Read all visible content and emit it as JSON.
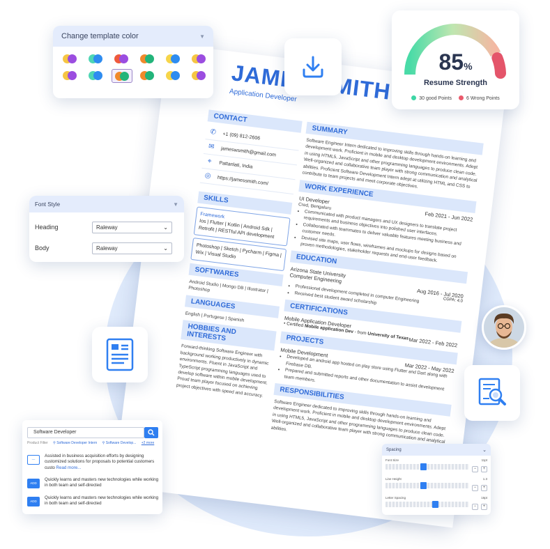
{
  "resume": {
    "name": "JAMES SMITH",
    "job_title": "Application Developer",
    "sections": {
      "contact": "CONTACT",
      "summary": "SUMMARY",
      "skills": "SKILLS",
      "work_experience": "WORK EXPERIENCE",
      "softwares": "SOFTWARES",
      "languages": "LANGUAGES",
      "education": "EDUCATION",
      "hobbies": "HOBBIES AND INTERESTS",
      "certifications": "CERTIFICATIONS",
      "projects": "PROJECTS",
      "responsibilities": "RESPONSIBILITIES"
    },
    "contact": {
      "phone": "+1 (09) 812-2606",
      "email": "jameswsmith@gmail.com",
      "location": "Pattanlati, India",
      "website": "https://jamessmith.com/"
    },
    "summary_text": "Software Engineer Intern dedicated to improving skills through hands-on learning and development work. Proficient in mobile and desktop development environments. Adept in using HTML5, JavaScript and other programming languages to produce clean code. Well-organized and collaborative team player with strong communication and analytical abilities. Proficient Software Development Intern adept at utilizing HTML and CSS to contribute to team projects and meet corporate objectives.",
    "skills": {
      "group1_title": "Framework",
      "group1": "Ios | Flutter | Kotlin | Android Sdk | Retrofit | RESTful API development",
      "group2": "Photoshop | Sketch | Pycharm | Figma | Wix | Visual Studio"
    },
    "work": {
      "role": "UI Developer",
      "company": "Cred, Bengaluru",
      "dates": "Feb 2021 - Jun 2022",
      "bullets": [
        "Communicated with product managers and UX designers to translate project requirements and business objectives into polished user interfaces.",
        "Collaborated with teammates to deliver valuable features meeting business and customer needs.",
        "Devised site maps, user flows, wireframes and mockups for designs based on proven methodologies, stakeholder requests and end-user feedback."
      ]
    },
    "softwares": "Android Studio | Mongo DB | Illustrator | Photoshop",
    "languages": "English | Portugese | Spanish",
    "education": {
      "school": "Arizona State University",
      "degree": "Computer Engineering",
      "dates": "Aug 2016 - Jul 2020",
      "cgpa": "CGPA: 4.0",
      "bullets": [
        "Professional development completed in computer Engineering",
        "Received best student award scholarship"
      ]
    },
    "hobbies_text": "Forward-thinking Software Engineer with background working productively in dynamic environments. Fluent in JavaScript and TypeScript programming languages used to develop software within mobile development. Proud team player focused on achieving project objectives with speed and accuracy.",
    "certification": {
      "title": "Mobile Application Developer",
      "dates": "Mar 2022 - Feb 2022",
      "certified_label": "Certified",
      "cert_name": "Mobile application Dev",
      "from_label": "from",
      "from": "University of Texas"
    },
    "project": {
      "title": "Mobile Development",
      "dates": "Mar 2022 - May 2022",
      "bullets": [
        "Developed an android app hosted on play store using Flutter and Dart along with Firebase DB.",
        "Prepared and submitted reports and other documentation to assist development team members."
      ]
    },
    "responsibilities_text": "Software Engineer dedicated to improving skills through hands-on learning and development work. Proficient in mobile and desktop development environments. Adept in using HTML5, JavaScript and other programming languages to produce clean code. Well-organized and collaborative team player with strong communication and analytical abilities."
  },
  "color_panel": {
    "title": "Change template color",
    "swatches": [
      [
        "#f6c543",
        "#9b4de0"
      ],
      [
        "#4ed6b4",
        "#2e8cf0"
      ],
      [
        "#ef5a3c",
        "#9b4de0"
      ],
      [
        "#f08a2c",
        "#22b47a"
      ],
      [
        "#f6d54a",
        "#2e8cf0"
      ],
      [
        "#f6c543",
        "#9b4de0"
      ],
      [
        "#f6c543",
        "#9b4de0"
      ],
      [
        "#4ed6b4",
        "#2e8cf0"
      ],
      [
        "#f08a2c",
        "#22b47a"
      ],
      [
        "#f08a2c",
        "#22b47a"
      ],
      [
        "#f6d54a",
        "#2e8cf0"
      ],
      [
        "#f6c543",
        "#9b4de0"
      ]
    ],
    "selected_index": 8
  },
  "strength": {
    "value": 85,
    "unit": "%",
    "label": "Resume Strength",
    "good_label": "30 good Points",
    "wrong_label": "6 Wrong Points",
    "good_color": "#3ed6a5",
    "wrong_color": "#ea5a6c"
  },
  "font_style": {
    "title": "Font Style",
    "heading_label": "Heading",
    "heading_value": "Raleway",
    "body_label": "Body",
    "body_value": "Raleway"
  },
  "search": {
    "query": "Software Developer",
    "filter_label": "Product Filter",
    "chips": [
      "Software Developer Intern",
      "Software Develop..."
    ],
    "more": "+2 more",
    "results": [
      {
        "tag": "",
        "text": "Assisted in business acquisition efforts by designing customized solutions for proposals to potential customers custo",
        "more": "Read more..."
      },
      {
        "tag": "ADD",
        "text": "Quickly learns and masters new technologies while working in both team and self-directed",
        "more": ""
      },
      {
        "tag": "ADD",
        "text": "Quickly learns and masters new technologies while working in both team and self-directed",
        "more": ""
      }
    ]
  },
  "spacing": {
    "title": "Spacing",
    "rows": [
      {
        "label": "Font Size",
        "value": "11pt",
        "level": 0.45
      },
      {
        "label": "Line Height",
        "value": "1.3",
        "level": 0.45
      },
      {
        "label": "Letter Spacing",
        "value": "16pt",
        "level": 0.6
      }
    ],
    "minus": "−",
    "plus": "+"
  },
  "colors": {
    "accent": "#2f6bd8",
    "brand_blue": "#2f7ff1"
  }
}
